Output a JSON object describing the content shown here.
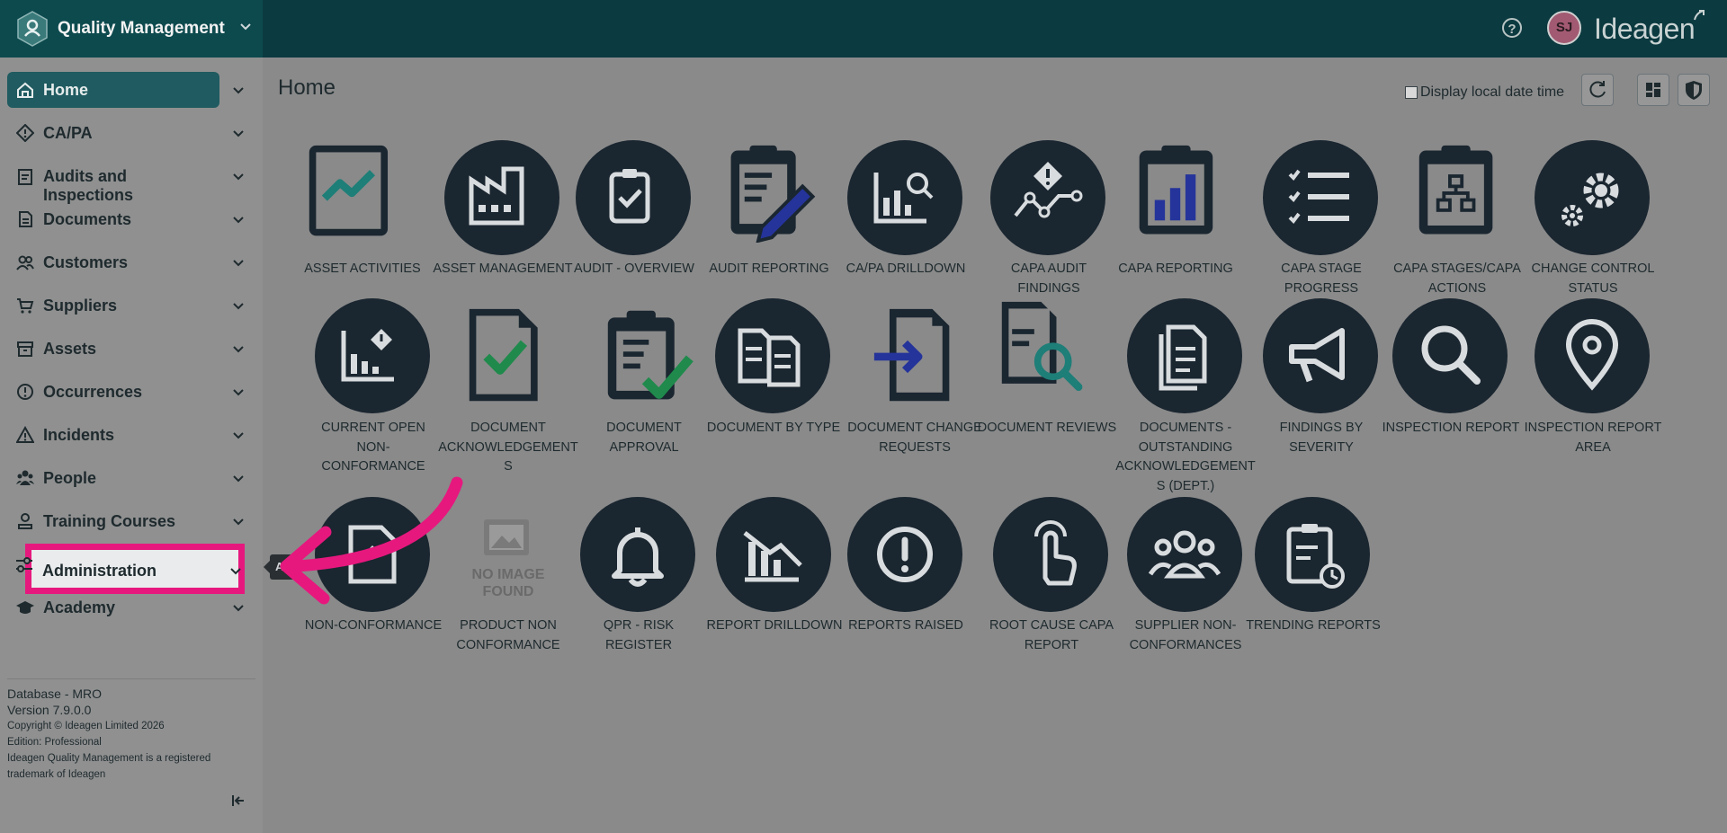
{
  "app": {
    "title": "Quality Management",
    "brand": "Ideagen",
    "user_initials": "SJ",
    "help_glyph": "?"
  },
  "sidebar": {
    "items": [
      {
        "label": "Home",
        "icon": "home-icon",
        "active": true
      },
      {
        "label": "CA/PA",
        "icon": "diamond-icon"
      },
      {
        "label": "Audits and Inspections",
        "icon": "clipboard-icon"
      },
      {
        "label": "Documents",
        "icon": "document-icon"
      },
      {
        "label": "Customers",
        "icon": "customers-icon"
      },
      {
        "label": "Suppliers",
        "icon": "cart-icon"
      },
      {
        "label": "Assets",
        "icon": "archive-icon"
      },
      {
        "label": "Occurrences",
        "icon": "alert-circle-icon"
      },
      {
        "label": "Incidents",
        "icon": "warning-icon"
      },
      {
        "label": "People",
        "icon": "people-icon"
      },
      {
        "label": "Training Courses",
        "icon": "training-icon"
      },
      {
        "label": "Administration",
        "icon": "sliders-icon",
        "highlighted": true
      },
      {
        "label": "Academy",
        "icon": "graduation-cap-icon"
      }
    ],
    "tooltip": "Ad",
    "footer": {
      "database": "Database - MRO",
      "version": "Version 7.9.0.0",
      "copyright": "Copyright © Ideagen Limited 2026",
      "edition": "Edition: Professional",
      "trademark_1": "Ideagen Quality Management is a registered",
      "trademark_2": "trademark of Ideagen"
    }
  },
  "main": {
    "title": "Home",
    "display_local_date_time": "Display local date time",
    "display_local_checked": false,
    "no_image_1": "NO IMAGE",
    "no_image_2": "FOUND",
    "tiles": [
      {
        "lines": [
          "ASSET ACTIVITIES"
        ],
        "icon": "chart-line-icon"
      },
      {
        "lines": [
          "ASSET MANAGEMENT"
        ],
        "icon": "factory-icon"
      },
      {
        "lines": [
          "AUDIT - OVERVIEW"
        ],
        "icon": "clipboard-check-icon"
      },
      {
        "lines": [
          "AUDIT REPORTING"
        ],
        "icon": "clipboard-pencil-icon"
      },
      {
        "lines": [
          "CA/PA DRILLDOWN"
        ],
        "icon": "chart-search-icon"
      },
      {
        "lines": [
          "CAPA AUDIT FINDINGS"
        ],
        "icon": "trend-alert-icon"
      },
      {
        "lines": [
          "CAPA REPORTING"
        ],
        "icon": "clipboard-bars-icon"
      },
      {
        "lines": [
          "CAPA STAGE",
          "PROGRESS"
        ],
        "icon": "checklist-icon"
      },
      {
        "lines": [
          "CAPA STAGES/CAPA",
          "ACTIONS"
        ],
        "icon": "clipboard-hierarchy-icon"
      },
      {
        "lines": [
          "CHANGE CONTROL",
          "STATUS"
        ],
        "icon": "gears-icon"
      },
      {
        "lines": [
          "CURRENT OPEN NON-",
          "CONFORMANCE"
        ],
        "icon": "chart-alert-icon"
      },
      {
        "lines": [
          "DOCUMENT",
          "ACKNOWLEDGEMENT",
          "S"
        ],
        "icon": "document-check-icon"
      },
      {
        "lines": [
          "DOCUMENT",
          "APPROVAL"
        ],
        "icon": "clipboard-approve-icon"
      },
      {
        "lines": [
          "DOCUMENT BY TYPE"
        ],
        "icon": "documents-icon"
      },
      {
        "lines": [
          "DOCUMENT CHANGE",
          "REQUESTS"
        ],
        "icon": "document-arrow-icon"
      },
      {
        "lines": [
          "DOCUMENT REVIEWS"
        ],
        "icon": "document-search-icon"
      },
      {
        "lines": [
          "DOCUMENTS -",
          "OUTSTANDING",
          "ACKNOWLEDGEMENT",
          "S (DEPT.)"
        ],
        "icon": "documents-stack-icon"
      },
      {
        "lines": [
          "FINDINGS BY SEVERITY"
        ],
        "icon": "megaphone-icon"
      },
      {
        "lines": [
          "INSPECTION REPORT"
        ],
        "icon": "magnifier-icon"
      },
      {
        "lines": [
          "INSPECTION REPORT",
          "AREA"
        ],
        "icon": "location-pin-icon"
      },
      {
        "lines": [
          "NON-CONFORMANCE"
        ],
        "icon": "document-alert-icon"
      },
      {
        "lines": [
          "PRODUCT NON",
          "CONFORMANCE"
        ],
        "icon": "no-image-icon"
      },
      {
        "lines": [
          "QPR - RISK REGISTER"
        ],
        "icon": "bell-icon"
      },
      {
        "lines": [
          "REPORT DRILLDOWN"
        ],
        "icon": "chart-decline-icon"
      },
      {
        "lines": [
          "REPORTS RAISED"
        ],
        "icon": "exclamation-circle-icon"
      },
      {
        "lines": [
          "ROOT CAUSE CAPA",
          "REPORT"
        ],
        "icon": "hand-pointer-icon"
      },
      {
        "lines": [
          "SUPPLIER NON-",
          "CONFORMANCES"
        ],
        "icon": "team-icon"
      },
      {
        "lines": [
          "TRENDING REPORTS"
        ],
        "icon": "clipboard-clock-icon"
      }
    ]
  },
  "colors": {
    "topbar": "#0b3a40",
    "active_nav": "#1f5b60",
    "highlight": "#e6187e",
    "tile_circle": "#1a2630",
    "accent_teal": "#1e7e78",
    "accent_blue": "#25349a",
    "accent_green": "#1f8a4c"
  }
}
